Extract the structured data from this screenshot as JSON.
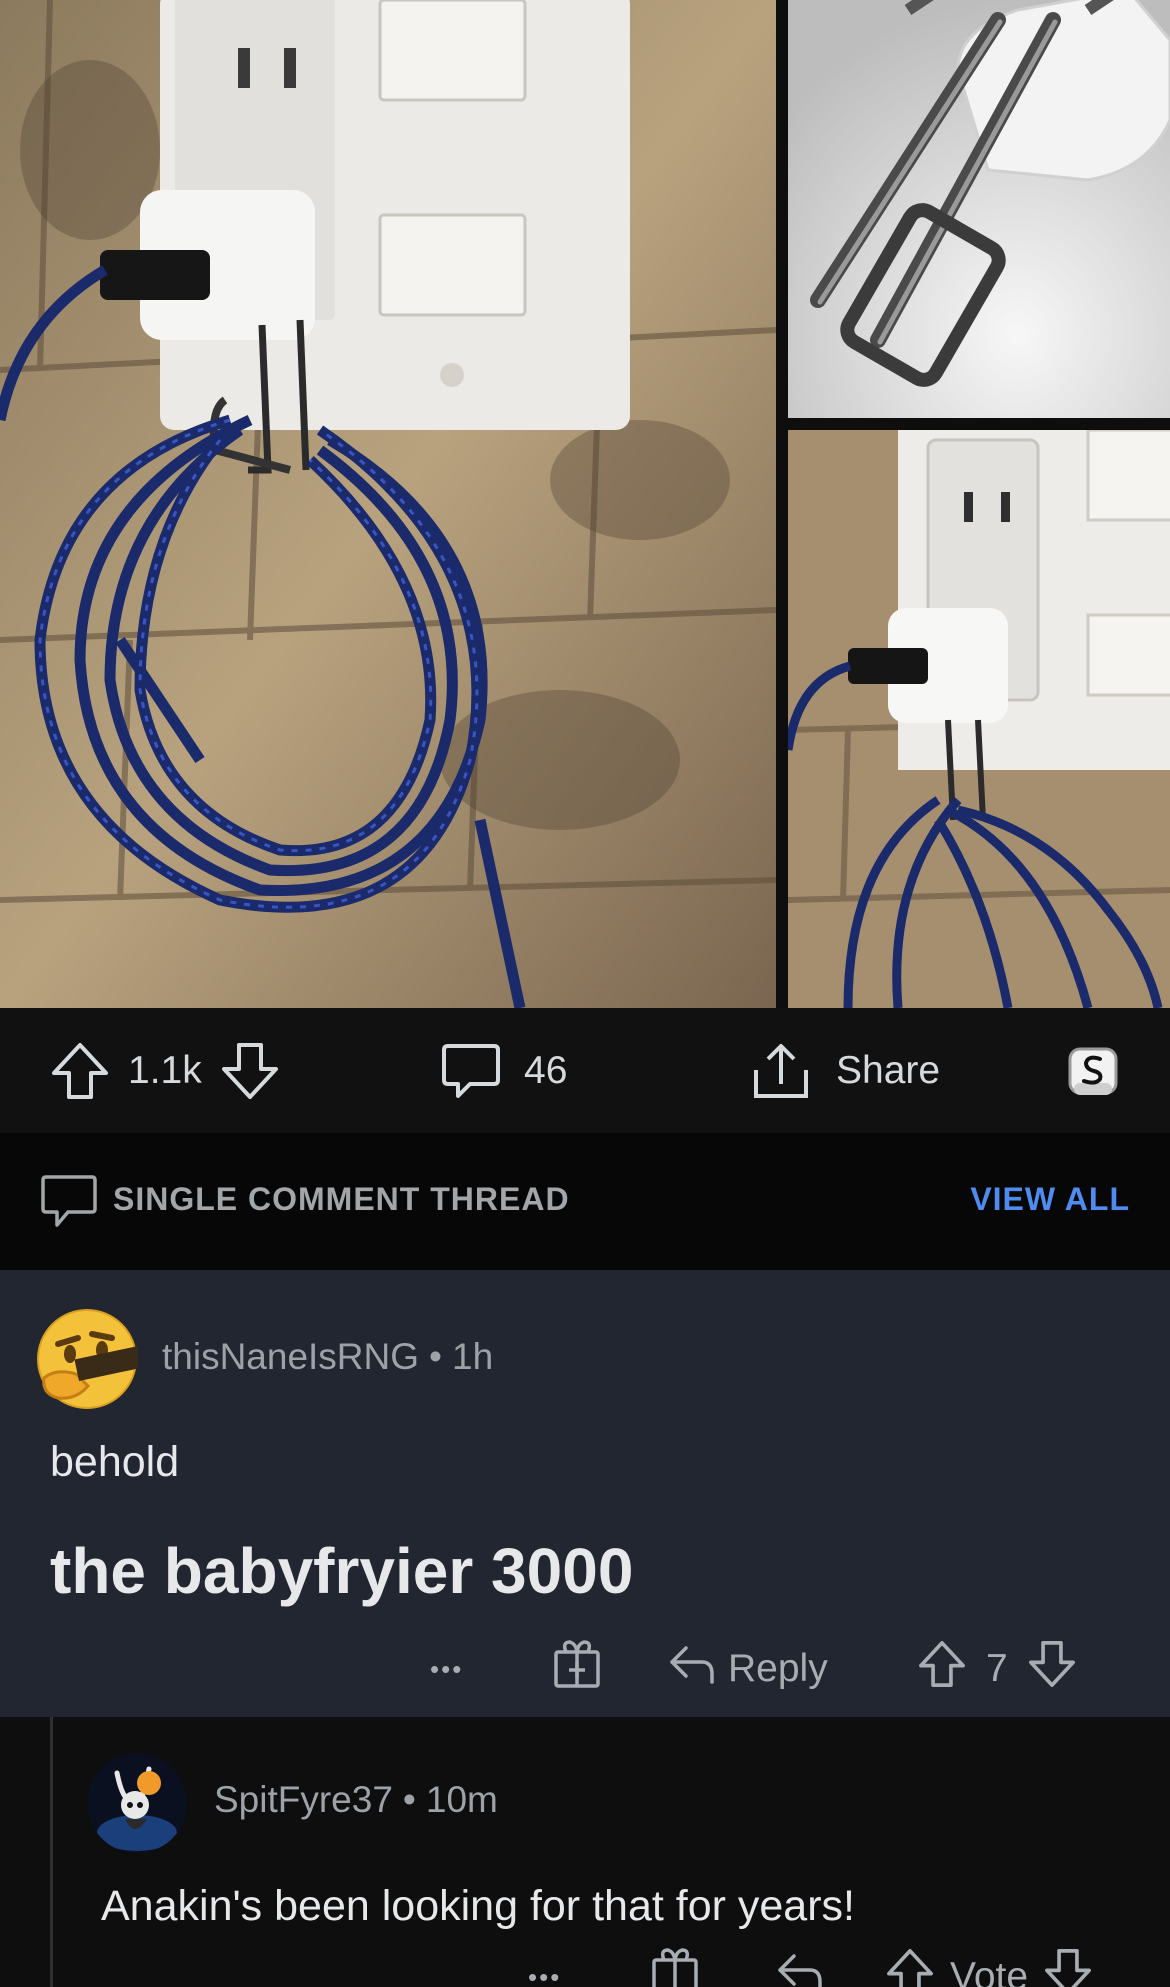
{
  "post": {
    "images": [
      {
        "name": "charger-hanging-cable-main",
        "description_icon": "photo"
      },
      {
        "name": "charger-hook-closeup",
        "description_icon": "photo"
      },
      {
        "name": "charger-hanging-cable-side",
        "description_icon": "photo"
      }
    ],
    "actions": {
      "upvotes": "1.1k",
      "comments": "46",
      "share_label": "Share"
    }
  },
  "thread": {
    "title": "SINGLE COMMENT THREAD",
    "view_all": "VIEW ALL"
  },
  "comment": {
    "username": "thisNaneIsRNG",
    "separator": "•",
    "age": "1h",
    "line1": "behold",
    "line2": "the babyfryier 3000",
    "more": "•••",
    "reply_label": "Reply",
    "votes": "7"
  },
  "reply": {
    "username": "SpitFyre37",
    "separator": "•",
    "age": "10m",
    "text": "Anakin's been looking for that for years!",
    "more": "•••",
    "vote_label": "Vote"
  },
  "colors": {
    "accent_link": "#4f8cf0",
    "comment_bg": "#212631",
    "page_bg": "#0e0e0f"
  }
}
